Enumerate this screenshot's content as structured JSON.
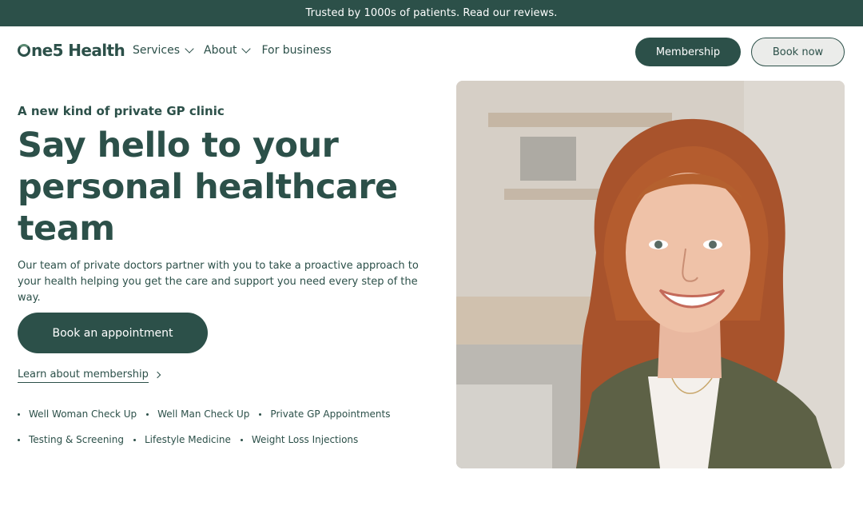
{
  "announcement": {
    "text": "Trusted by 1000s of patients. Read our reviews."
  },
  "brand": {
    "logo_text": "ne5 Health"
  },
  "nav": {
    "items": [
      {
        "label": "Services",
        "has_dropdown": true
      },
      {
        "label": "About",
        "has_dropdown": true
      },
      {
        "label": "For business",
        "has_dropdown": false
      }
    ],
    "membership_label": "Membership",
    "book_now_label": "Book now"
  },
  "hero": {
    "eyebrow": "A new kind of private GP clinic",
    "title": "Say hello to your personal healthcare team",
    "description": "Our team of private doctors partner with you to take a proactive approach to your health helping you get the care and support you need every step of the way.",
    "cta_label": "Book an appointment",
    "secondary_link": "Learn about membership"
  },
  "services": {
    "row1": [
      "Well Woman Check Up",
      "Well Man Check Up",
      "Private GP Appointments"
    ],
    "row2": [
      "Testing & Screening",
      "Lifestyle Medicine",
      "Weight Loss Injections"
    ]
  },
  "colors": {
    "brand_dark_green": "#2c5049",
    "background": "#ffffff",
    "secondary_button_bg": "#ebecea"
  },
  "icons": [
    "chevron-down-icon",
    "chevron-right-icon",
    "bullet-dot-icon"
  ]
}
